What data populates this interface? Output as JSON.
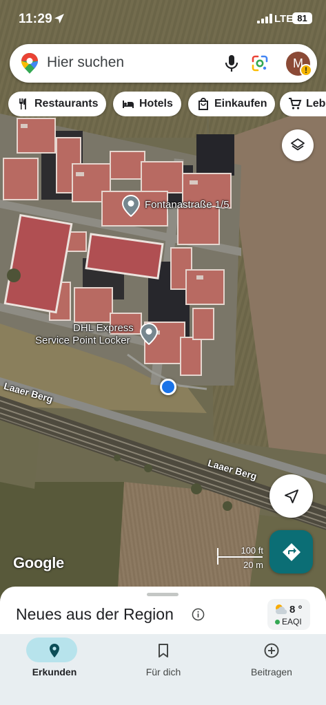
{
  "status_bar": {
    "time": "11:29",
    "network": "LTE",
    "battery": "81"
  },
  "search": {
    "placeholder": "Hier suchen",
    "avatar_initial": "M"
  },
  "chips": [
    {
      "label": "Restaurants",
      "icon": "fork-knife-icon"
    },
    {
      "label": "Hotels",
      "icon": "bed-icon"
    },
    {
      "label": "Einkaufen",
      "icon": "shopping-bag-icon"
    },
    {
      "label": "Lebe",
      "icon": "cart-icon"
    }
  ],
  "map": {
    "places": [
      {
        "label": "Fontanastraße 1/5"
      },
      {
        "label_line1": "DHL Express",
        "label_line2": "Service Point Locker"
      }
    ],
    "roads": [
      "Laaer Berg",
      "Laaer Berg"
    ],
    "attribution": "Google",
    "scale": {
      "imperial": "100 ft",
      "metric": "20 m"
    }
  },
  "sheet": {
    "title": "Neues aus der Region",
    "weather_temp": "8 °",
    "weather_aqi": "EAQI"
  },
  "nav": [
    {
      "label": "Erkunden",
      "icon": "explore-pin-icon",
      "active": true
    },
    {
      "label": "Für dich",
      "icon": "bookmark-icon",
      "active": false
    },
    {
      "label": "Beitragen",
      "icon": "plus-circle-icon",
      "active": false
    }
  ],
  "colors": {
    "accent": "#0b6e75",
    "active_pill": "#b7e3ec",
    "location_dot": "#1a73e8"
  }
}
